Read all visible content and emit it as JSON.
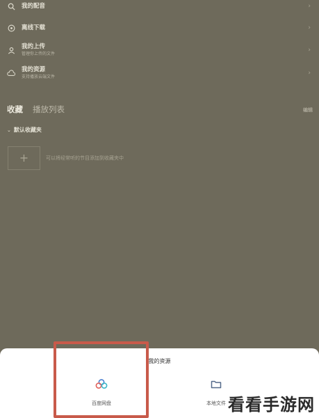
{
  "menu": [
    {
      "id": "purchased",
      "title": "我的配音",
      "sub": "",
      "icon": "search-icon"
    },
    {
      "id": "offline",
      "title": "离线下载",
      "sub": "",
      "icon": "globe-icon"
    },
    {
      "id": "uploads",
      "title": "我的上传",
      "sub": "管理你上传的文件",
      "icon": "user-icon"
    },
    {
      "id": "resources",
      "title": "我的资源",
      "sub": "支持播放云端文件",
      "icon": "cloud-icon"
    }
  ],
  "collection": {
    "tab_fav": "收藏",
    "tab_playlist": "播放列表",
    "edit": "编辑",
    "default_folder": "默认收藏夹",
    "add_hint": "可以将经常听的节目添加到收藏夹中"
  },
  "sheet": {
    "title": "我的资源",
    "options": [
      {
        "label": "百度网盘",
        "icon": "baidu-netdisk-icon"
      },
      {
        "label": "本地文件",
        "icon": "folder-icon"
      }
    ]
  },
  "watermark": "看看手游网",
  "colors": {
    "highlight": "#c85a4a",
    "overlay": "#6e6a5b",
    "sheet": "#ffffff"
  }
}
